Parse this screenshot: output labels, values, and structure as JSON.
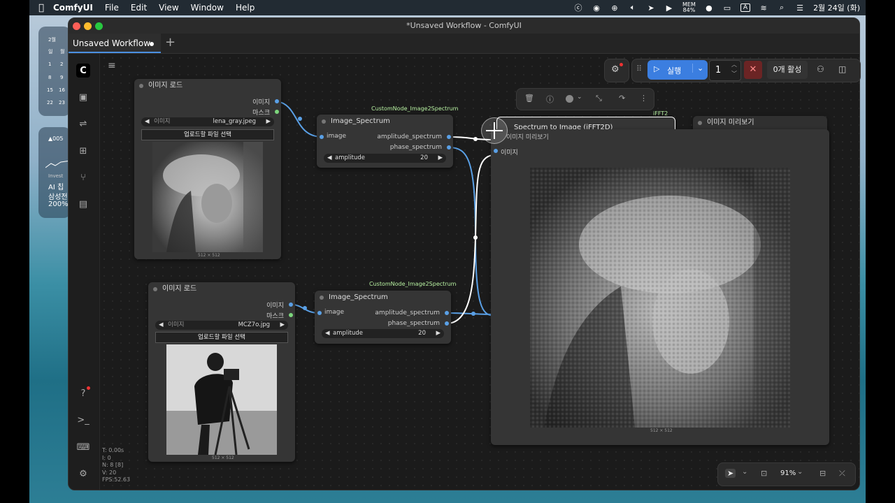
{
  "menubar": {
    "app": "ComfyUI",
    "items": [
      "File",
      "Edit",
      "View",
      "Window",
      "Help"
    ],
    "battery": "84%",
    "input_indicator": "A",
    "datetime": "2월 24일 (화)"
  },
  "widgets": {
    "calendar": {
      "month": "2월",
      "weekday_labels": [
        "일",
        "월"
      ],
      "rows": [
        [
          "1",
          "2"
        ],
        [
          "8",
          "9"
        ],
        [
          "15",
          "16"
        ],
        [
          "22",
          "23"
        ]
      ]
    },
    "stock": {
      "title": "▲005",
      "label": "Invest",
      "headline": "AI 칩",
      "company": "삼성전",
      "value": "200%"
    }
  },
  "window": {
    "title": "*Unsaved Workflow - ComfyUI",
    "tab_label": "Unsaved Workflow"
  },
  "toolbar": {
    "run_label": "실행",
    "batch_count": "1",
    "active_label": "0개 활성",
    "zoom": "91%"
  },
  "nodes": {
    "load1": {
      "title": "이미지 로드",
      "out_image": "이미지",
      "out_mask": "마스크",
      "widget_label": "이미지",
      "widget_value": "lena_gray.jpeg",
      "upload_label": "업로드할 파일 선택",
      "size": "512 × 512"
    },
    "load2": {
      "title": "이미지 로드",
      "out_image": "이미지",
      "out_mask": "마스크",
      "widget_label": "이미지",
      "widget_value": "MCZ7o.jpg",
      "upload_label": "업로드할 파일 선택",
      "size": "512 × 512"
    },
    "spec1": {
      "pipe": "CustomNode_Image2Spectrum",
      "title": "Image_Spectrum",
      "in_image": "image",
      "out_amp": "amplitude_spectrum",
      "out_phase": "phase_spectrum",
      "widget_label": "amplitude",
      "widget_value": "20"
    },
    "spec2": {
      "pipe": "CustomNode_Image2Spectrum",
      "title": "Image_Spectrum",
      "in_image": "image",
      "out_amp": "amplitude_spectrum",
      "out_phase": "phase_spectrum",
      "widget_label": "amplitude",
      "widget_value": "20"
    },
    "ifft": {
      "pipe": "iFFT2",
      "title": "Spectrum to Image (iFFT2D)"
    },
    "preview_back": {
      "title": "이미지 미리보기"
    },
    "preview_front": {
      "title": "이미지 미리보기",
      "in_image": "이미지",
      "size": "512 × 512"
    }
  },
  "stats": [
    "T: 0.00s",
    "I: 0",
    "N: 8 [8]",
    "V: 20",
    "FPS:52.63"
  ],
  "colors": {
    "accent": "#3b7ee0",
    "link_blue": "#5aa0e6",
    "pipe_green": "#b6f0a0",
    "cancel_red": "#7a2a2a"
  }
}
